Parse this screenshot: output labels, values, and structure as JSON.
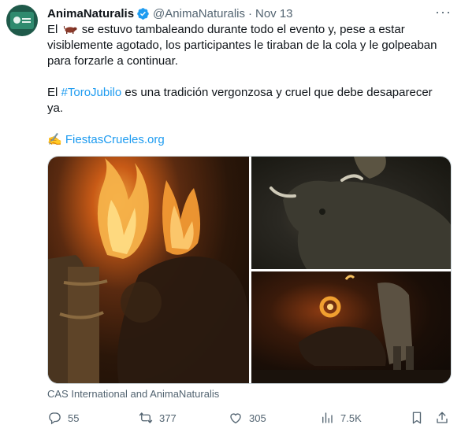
{
  "author": {
    "name": "AnimaNaturalis",
    "handle": "@AnimaNaturalis",
    "separator": "·",
    "date": "Nov 13"
  },
  "tweet": {
    "line1_before": "El",
    "line1_after": "se estuvo tambaleando durante todo el evento y, pese a estar visiblemente agotado, los participantes le tiraban de la cola y le golpeaban para forzarle a continuar.",
    "line2_before": "El",
    "hashtag": "#ToroJubilo",
    "line2_after": "es una tradición vergonzosa y cruel que debe desaparecer ya.",
    "link_emoji": "✍️",
    "link_text": "FiestasCrueles.org"
  },
  "media": {
    "caption": "CAS International and AnimaNaturalis"
  },
  "actions": {
    "replies": "55",
    "retweets": "377",
    "likes": "305",
    "views": "7.5K"
  },
  "colors": {
    "accent": "#1d9bf0",
    "secondary_text": "#536471",
    "verified": "#1d9bf0"
  },
  "icons": [
    "verified-badge-icon",
    "more-icon",
    "cow-emoji-icon",
    "writing-hand-icon",
    "reply-icon",
    "retweet-icon",
    "like-icon",
    "views-icon",
    "bookmark-icon",
    "share-icon"
  ]
}
